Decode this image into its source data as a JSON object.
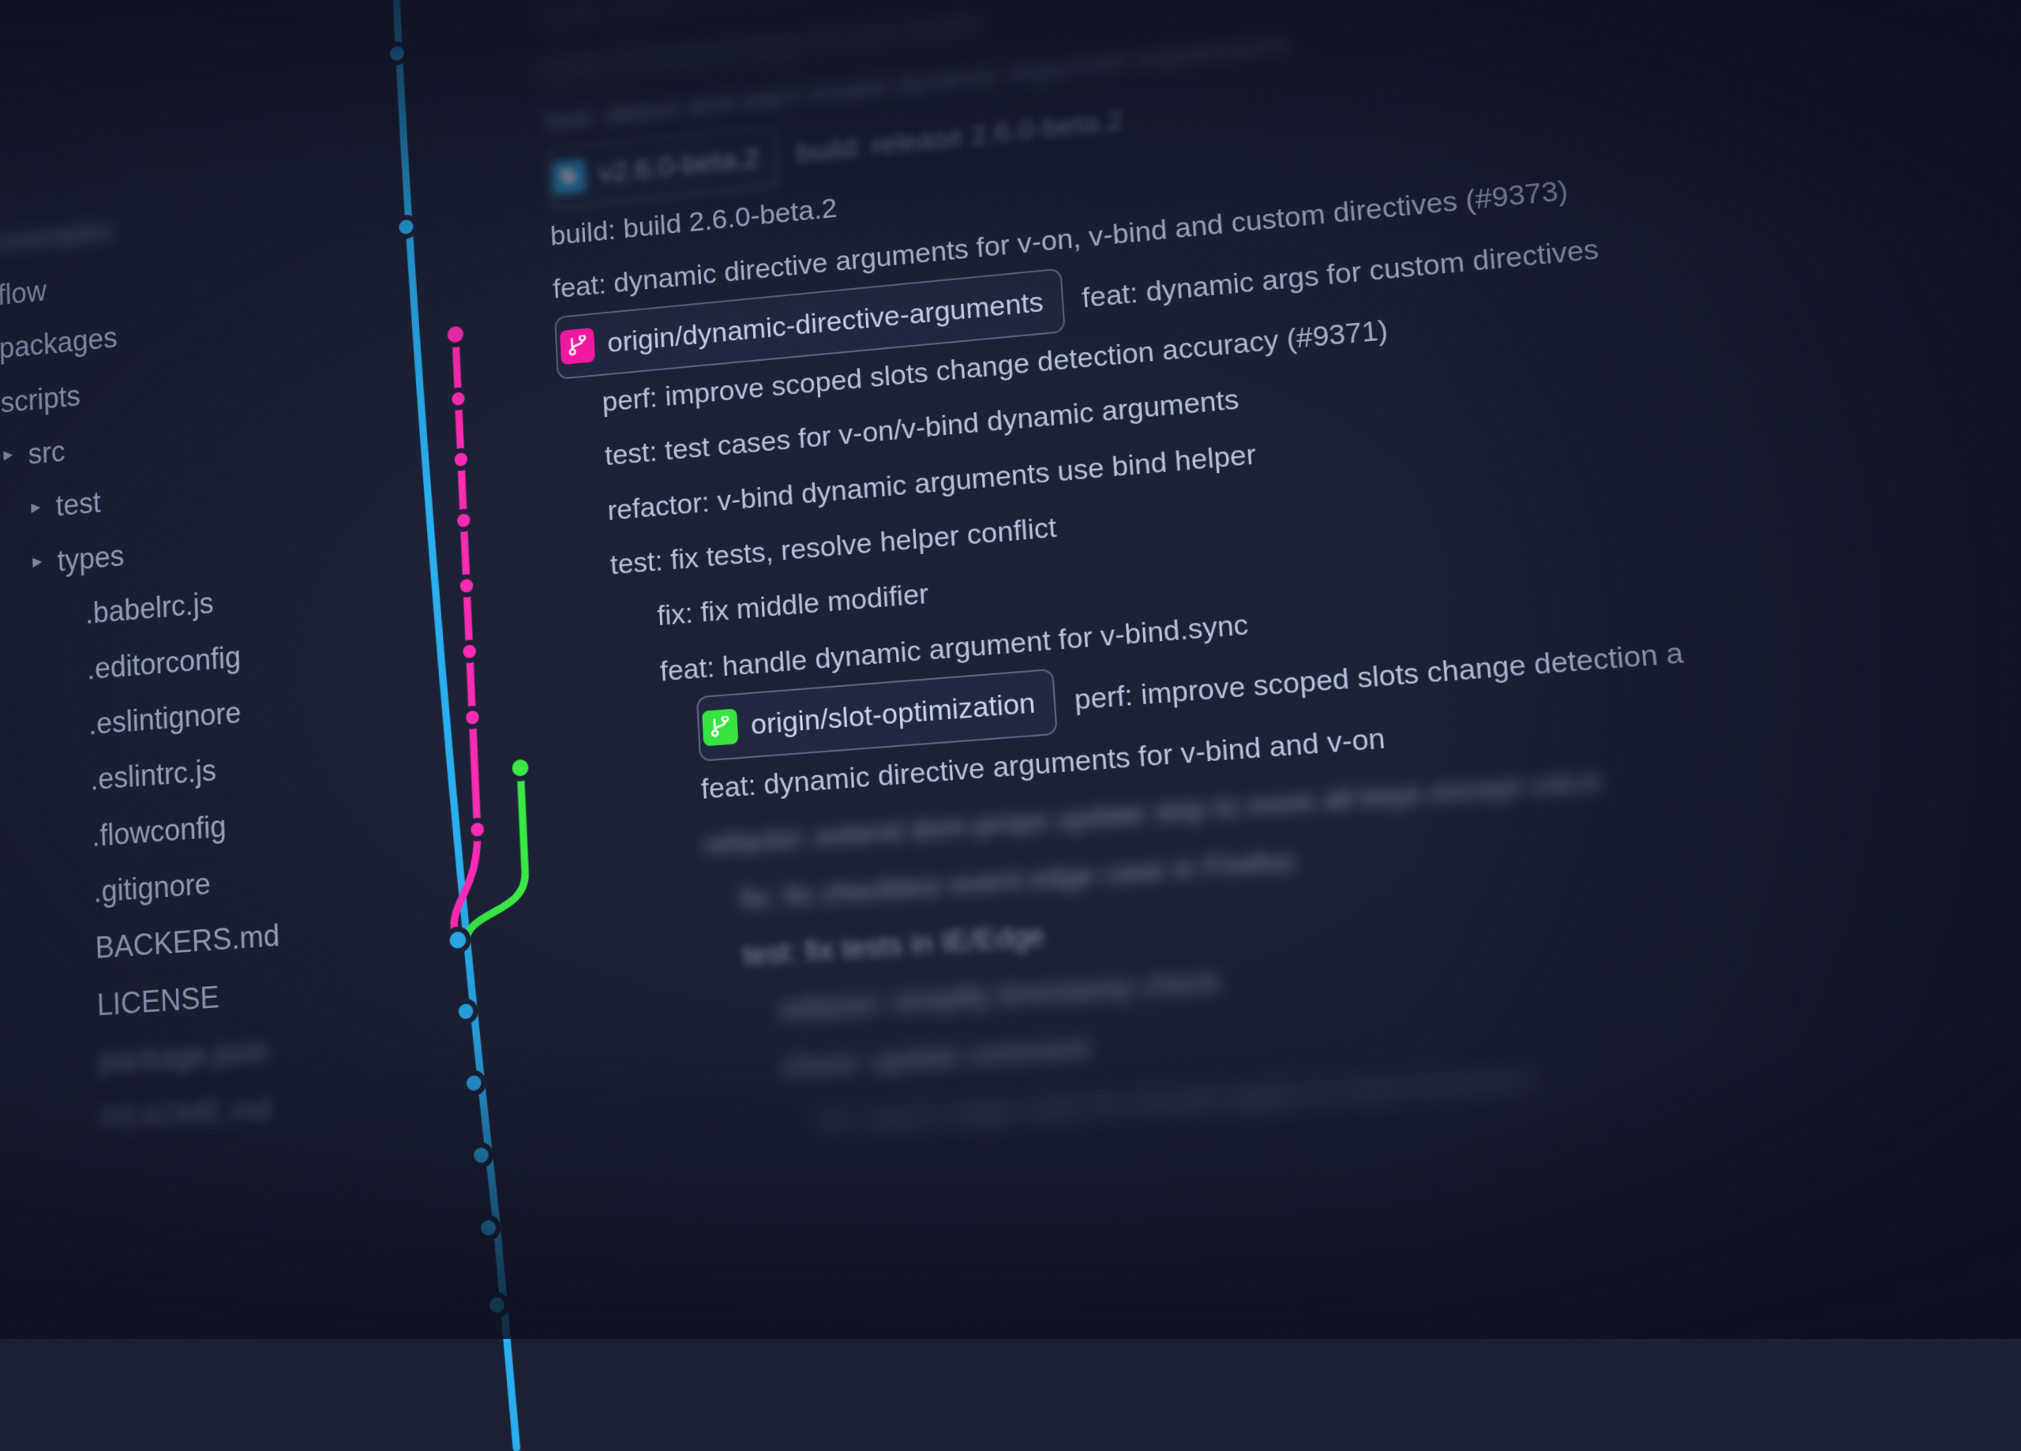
{
  "colors": {
    "bg": "#1c2135",
    "blue": "#29aef0",
    "pink": "#ff2bb2",
    "green": "#38e845",
    "text": "#a9b4d4"
  },
  "tree": [
    {
      "label": "",
      "chev": "blank",
      "cls": "blurTop"
    },
    {
      "label": "",
      "chev": "blank",
      "cls": "blurTop"
    },
    {
      "label": "",
      "chev": "blank",
      "cls": "blurTop"
    },
    {
      "label": "",
      "chev": "blank",
      "cls": "blurTop"
    },
    {
      "label": "examples",
      "chev": "right",
      "indent": 0,
      "cls": "blurTop"
    },
    {
      "label": "flow",
      "chev": "right",
      "indent": 0
    },
    {
      "label": "packages",
      "chev": "right",
      "indent": 0
    },
    {
      "label": "scripts",
      "chev": "right",
      "indent": 0
    },
    {
      "label": "src",
      "chev": "right",
      "indent": 1
    },
    {
      "label": "test",
      "chev": "right",
      "indent": 2
    },
    {
      "label": "types",
      "chev": "right",
      "indent": 2
    },
    {
      "label": ".babelrc.js",
      "chev": "blank",
      "indent": 3
    },
    {
      "label": ".editorconfig",
      "chev": "blank",
      "indent": 3
    },
    {
      "label": ".eslintignore",
      "chev": "blank",
      "indent": 3
    },
    {
      "label": ".eslintrc.js",
      "chev": "blank",
      "indent": 3
    },
    {
      "label": ".flowconfig",
      "chev": "blank",
      "indent": 3
    },
    {
      "label": ".gitignore",
      "chev": "blank",
      "indent": 3
    },
    {
      "label": "BACKERS.md",
      "chev": "blank",
      "indent": 3
    },
    {
      "label": "LICENSE",
      "chev": "blank",
      "indent": 3
    },
    {
      "label": "package.json",
      "chev": "blank",
      "indent": 3,
      "cls": "blurBot"
    },
    {
      "label": "README.md",
      "chev": "blank",
      "indent": 3,
      "cls": "blurBot"
    }
  ],
  "commits": [
    {
      "msg": "build: build 2.6.0-beta.3",
      "cls": "blurA",
      "offset": 0
    },
    {
      "msg": "build: fix feature flags for esm builds",
      "cls": "blurA",
      "offset": 0
    },
    {
      "msg": "feat: detect and warn invalid dynamic argument expressions",
      "cls": "blurB",
      "offset": 0
    },
    {
      "tag": {
        "color": "blueB",
        "icon": "tag",
        "label": "v2.6.0-beta.2"
      },
      "msg": "build: release 2.6.0-beta.2",
      "cls": "blurC",
      "offset": 0
    },
    {
      "msg": "build: build 2.6.0-beta.2",
      "offset": 0
    },
    {
      "msg": "feat: dynamic directive arguments for v-on, v-bind and custom directives (#9373)",
      "offset": 0,
      "cls": "blurRfar"
    },
    {
      "tag": {
        "color": "pinkB",
        "icon": "branch",
        "label": "origin/dynamic-directive-arguments"
      },
      "msg": "feat: dynamic args for custom directives",
      "offset": 0
    },
    {
      "msg": "perf: improve scoped slots change detection accuracy (#9371)",
      "offset": 1
    },
    {
      "msg": "test: test cases for v-on/v-bind dynamic arguments",
      "offset": 1
    },
    {
      "msg": "refactor: v-bind dynamic arguments use bind helper",
      "offset": 1
    },
    {
      "msg": "test: fix tests, resolve helper conflict",
      "offset": 1
    },
    {
      "msg": "fix: fix middle modifier",
      "offset": 2
    },
    {
      "msg": "feat: handle dynamic argument for v-bind.sync",
      "offset": 2
    },
    {
      "tag": {
        "color": "greenB",
        "icon": "branch",
        "label": "origin/slot-optimization"
      },
      "msg": "perf: improve scoped slots change detection a",
      "offset": 3,
      "cls": "blurRfar"
    },
    {
      "msg": "feat: dynamic directive arguments for v-bind and v-on",
      "offset": 3
    },
    {
      "msg": "refactor: extend dom-props update skip to more all keys except value",
      "offset": 3,
      "cls": "blurB"
    },
    {
      "msg": "fix: fix checkbox event edge case in Firefox",
      "offset": 4,
      "cls": "blurB"
    },
    {
      "msg": "test: fix tests in IE/Edge",
      "offset": 4,
      "cls": "blurC"
    },
    {
      "msg": "refactor: simplify timestamp check",
      "offset": 5,
      "cls": "blurD"
    },
    {
      "msg": "chore: update comment",
      "offset": 5,
      "cls": "blurD"
    },
    {
      "msg": "fix: async edge case fix should apply to more browsers",
      "offset": 6,
      "cls": "blurE"
    }
  ]
}
